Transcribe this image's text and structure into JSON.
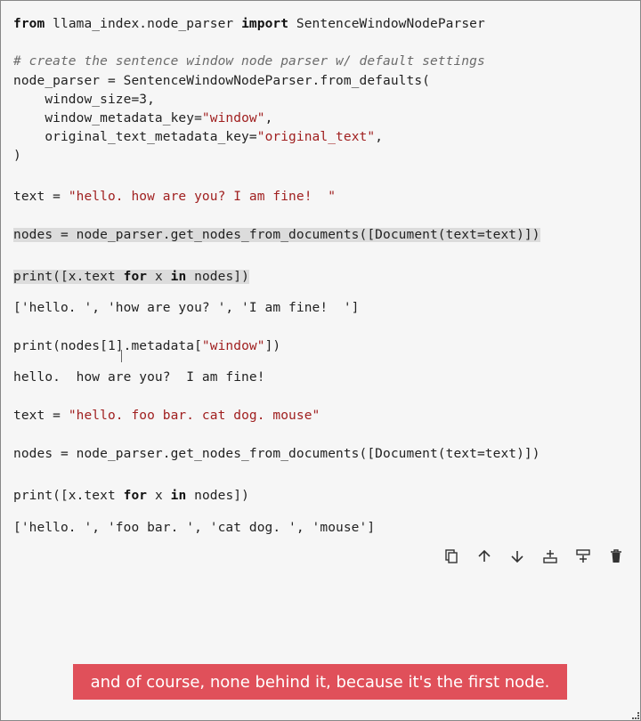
{
  "code": {
    "import_kw1": "from",
    "import_mod": " llama_index.node_parser ",
    "import_kw2": "import",
    "import_name": " SentenceWindowNodeParser",
    "comment": "# create the sentence window node parser w/ default settings",
    "np_line": "node_parser = SentenceWindowNodeParser.from_defaults(",
    "arg1": "    window_size=3,",
    "arg2_a": "    window_metadata_key=",
    "arg2_b": "\"window\"",
    "arg2_c": ",",
    "arg3_a": "    original_text_metadata_key=",
    "arg3_b": "\"original_text\"",
    "arg3_c": ",",
    "close_paren": ")",
    "text1_a": "text = ",
    "text1_b": "\"hello. how are you? I am fine!  \"",
    "nodes1": "nodes = node_parser.get_nodes_from_documents([Document(text=text)])",
    "print1_a": "print([x.text ",
    "print1_for": "for",
    "print1_b": " x ",
    "print1_in": "in",
    "print1_c": " nodes])",
    "out1": "['hello. ', 'how are you? ', 'I am fine!  ']",
    "print2_a": "print(nodes[1].metadata[",
    "print2_b": "\"window\"",
    "print2_c": "])",
    "out2": "hello.  how are you?  I am fine!",
    "text2_a": "text = ",
    "text2_b": "\"hello. foo bar. cat dog. mouse\"",
    "nodes2": "nodes = node_parser.get_nodes_from_documents([Document(text=text)])",
    "print3_a": "print([x.text ",
    "print3_for": "for",
    "print3_b": " x ",
    "print3_in": "in",
    "print3_c": " nodes])",
    "out3": "['hello. ', 'foo bar. ', 'cat dog. ', 'mouse']"
  },
  "toolbar": {
    "icons": [
      "duplicate-icon",
      "move-up-icon",
      "move-down-icon",
      "insert-below-icon",
      "insert-above-icon",
      "delete-icon"
    ]
  },
  "caption": {
    "text": "and of course, none behind it, because it's the first node."
  },
  "colors": {
    "caption_bg": "#e0505a",
    "string": "#a02020",
    "comment": "#6b6b6b"
  }
}
